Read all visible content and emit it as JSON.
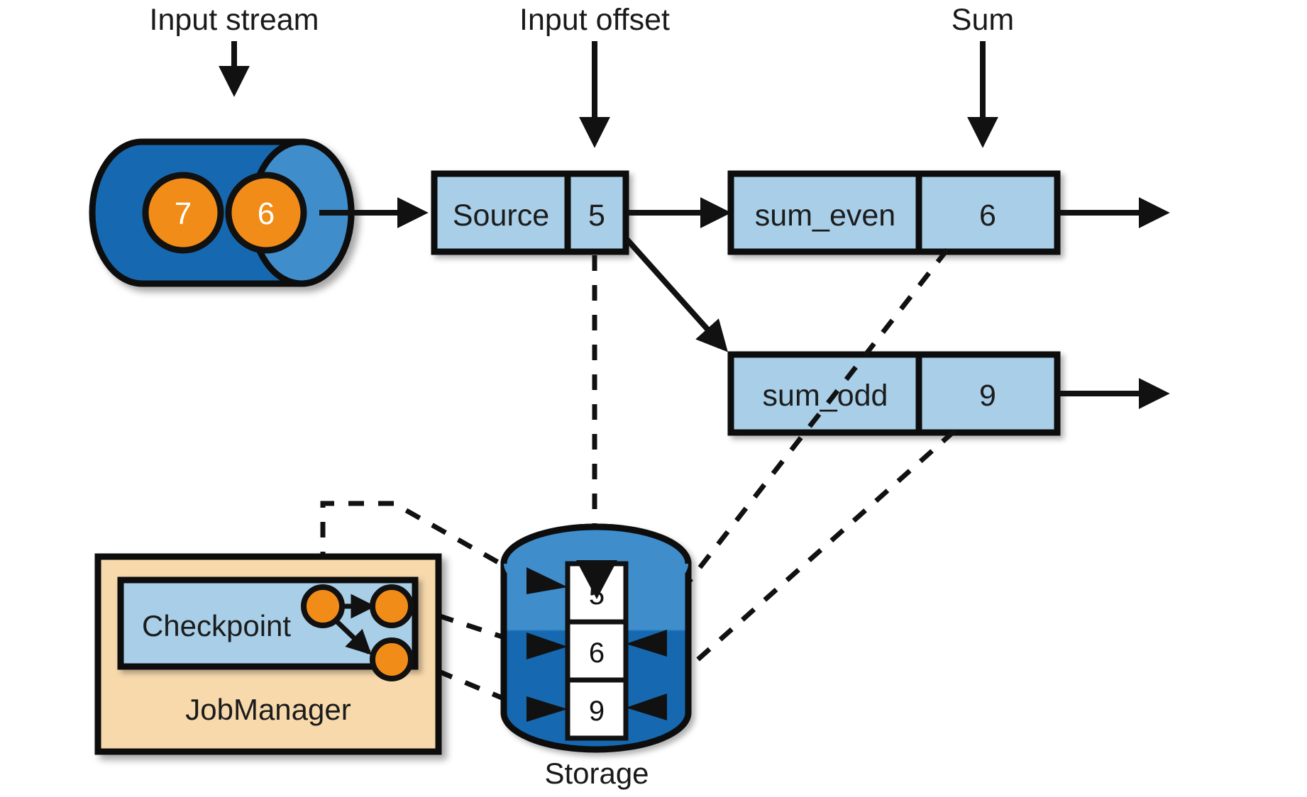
{
  "labels": {
    "input_stream": "Input stream",
    "input_offset": "Input offset",
    "sum": "Sum",
    "storage": "Storage",
    "jobmanager": "JobManager",
    "checkpoint": "Checkpoint"
  },
  "input_stream": {
    "records": [
      "7",
      "6"
    ]
  },
  "source": {
    "name": "Source",
    "offset": "5"
  },
  "operators": [
    {
      "name": "sum_even",
      "value": "6"
    },
    {
      "name": "sum_odd",
      "value": "9"
    }
  ],
  "storage": {
    "label": "Storage",
    "cells": [
      "5",
      "6",
      "9"
    ]
  },
  "colors": {
    "stream_dark_blue": "#1269b0",
    "stream_light_blue": "#3f8dcc",
    "record_orange": "#f28c18",
    "box_blue": "#a8cee8",
    "jobmanager_tan": "#f7d9ac",
    "outline": "#111111",
    "white": "#ffffff"
  }
}
